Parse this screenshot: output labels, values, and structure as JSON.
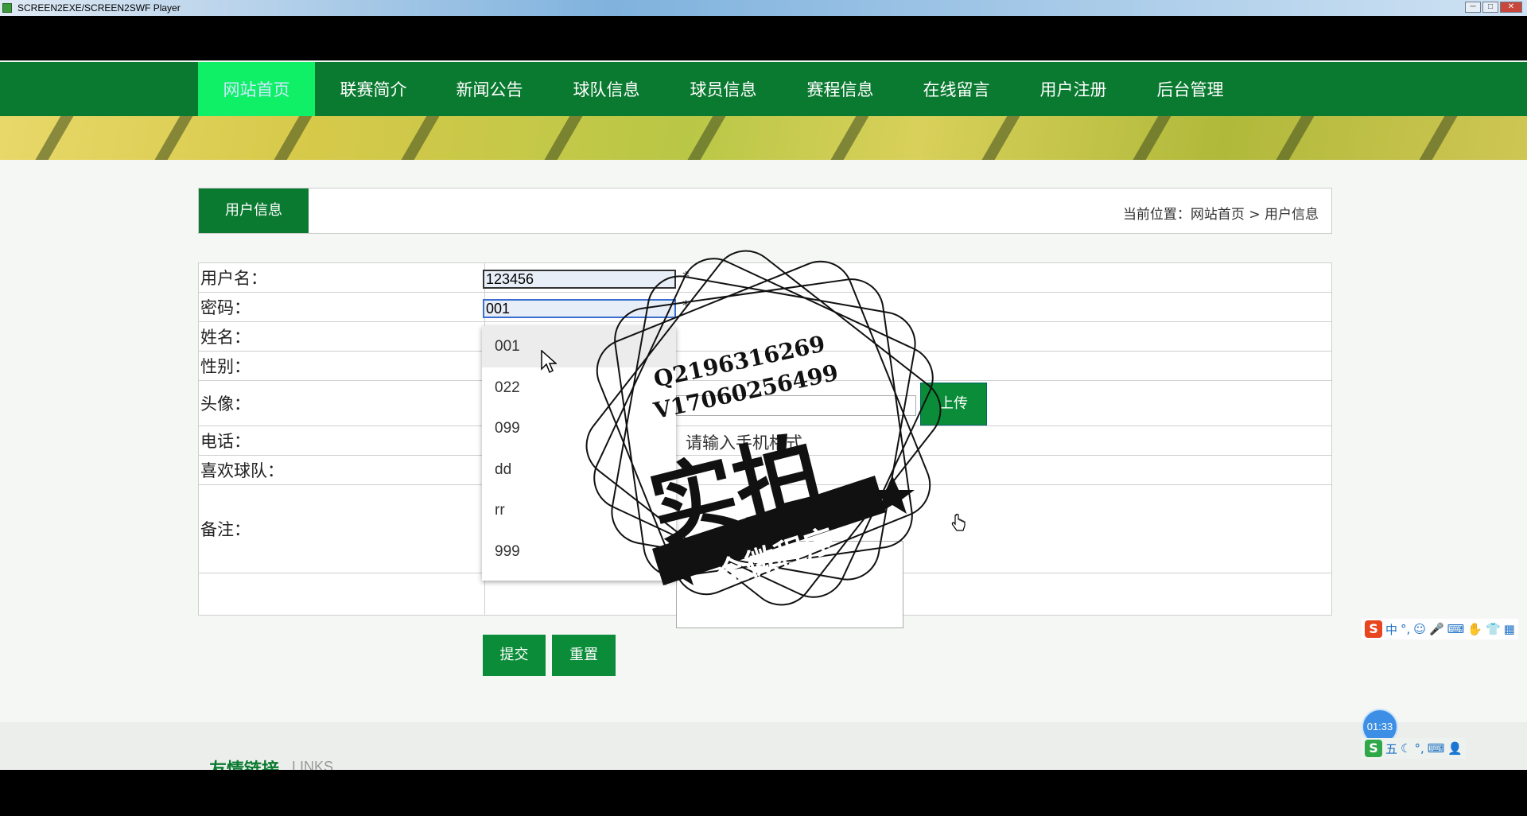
{
  "window": {
    "title": "SCREEN2EXE/SCREEN2SWF Player",
    "controls": [
      "─",
      "□",
      "✕"
    ]
  },
  "nav": {
    "items": [
      "网站首页",
      "联赛简介",
      "新闻公告",
      "球队信息",
      "球员信息",
      "赛程信息",
      "在线留言",
      "用户注册",
      "后台管理"
    ],
    "active_index": 0
  },
  "page": {
    "tab_title": "用户信息",
    "breadcrumb": "当前位置：网站首页 > 用户信息"
  },
  "form": {
    "labels": {
      "username": "用户名：",
      "password": "密码：",
      "name": "姓名：",
      "gender": "性别：",
      "avatar": "头像：",
      "phone": "电话：",
      "team": "喜欢球队：",
      "remark": "备注："
    },
    "username_value": "123456",
    "password_value": "001",
    "required_mark": "*",
    "phone_hint": "请输入手机格式",
    "upload_label": "上传",
    "submit_label": "提交",
    "reset_label": "重置"
  },
  "autocomplete": {
    "options": [
      "001",
      "022",
      "099",
      "dd",
      "rr",
      "999"
    ]
  },
  "watermark": {
    "line1": "Q2196316269",
    "line2": "V17060256499",
    "big": "实拍",
    "ribbon": "全微程序"
  },
  "footer": {
    "links_cn": "友情链接",
    "links_en": "LINKS"
  },
  "ime": {
    "toolbar_top": [
      "中",
      "°,",
      "☺",
      "🎤",
      "⌨",
      "✋",
      "👕",
      "▦"
    ],
    "toolbar_bottom": [
      "五",
      "☾",
      "°,",
      "⌨",
      "👤"
    ],
    "logo": "S"
  },
  "timer": "01:33",
  "colors": {
    "nav_green": "#0a7a30",
    "active_tab": "#0ff066",
    "button_green": "#0a8c38"
  }
}
